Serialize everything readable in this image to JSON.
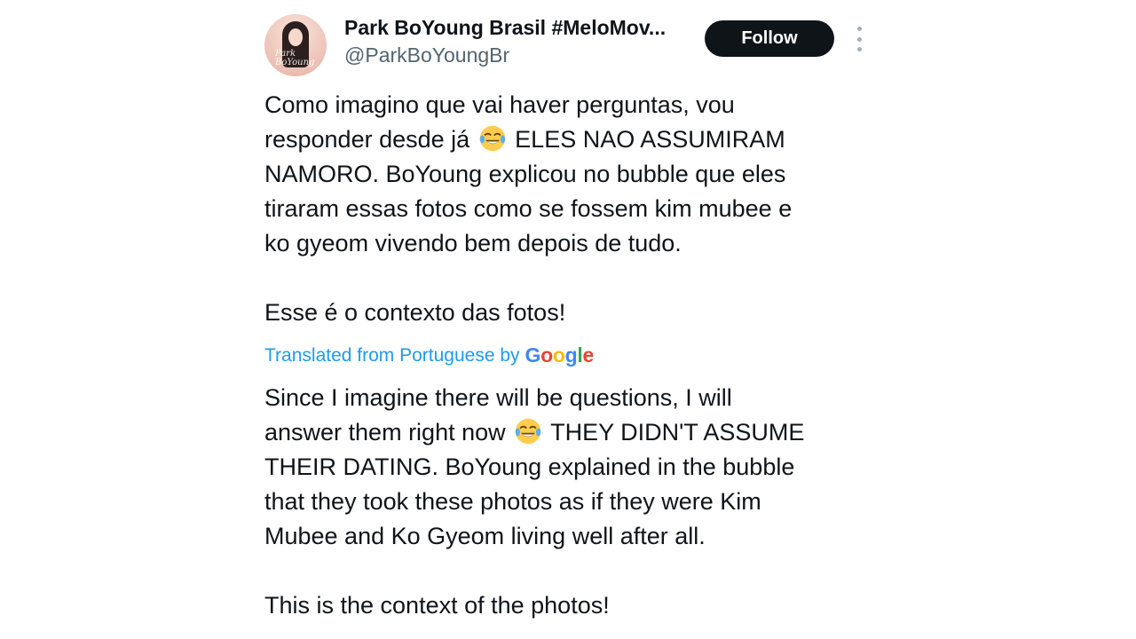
{
  "tweet": {
    "display_name": "Park BoYoung Brasil #MeloMov...",
    "handle": "@ParkBoYoungBr",
    "follow_label": "Follow",
    "more_icon": "more-vertical-icon",
    "avatar_icon": "profile-photo",
    "original": {
      "line1_before_emoji": "Como imagino que vai haver perguntas, vou\nresponder desde já ",
      "emoji": "face-with-tears-of-joy",
      "line1_after_emoji": " ELES NAO ASSUMIRAM\nNAMORO. BoYoung explicou no bubble que eles\ntiraram essas fotos como se fossem kim mubee e\nko gyeom vivendo bem depois de tudo.\n\nEsse é o contexto das fotos!"
    },
    "translated_from": "Translated from Portuguese by",
    "translator_brand": "Google",
    "translation": {
      "before_emoji": "Since I imagine there will be questions, I will\nanswer them right now ",
      "emoji": "face-with-tears-of-joy",
      "after_emoji": " THEY DIDN'T ASSUME\nTHEIR DATING. BoYoung explained in the bubble\nthat they took these photos as if they were Kim\nMubee and Ko Gyeom living well after all.\n\nThis is the context of the photos!"
    }
  },
  "colors": {
    "text": "#0f1419",
    "secondary": "#536471",
    "link": "#1d9bf0",
    "follow_bg": "#0f1419"
  }
}
